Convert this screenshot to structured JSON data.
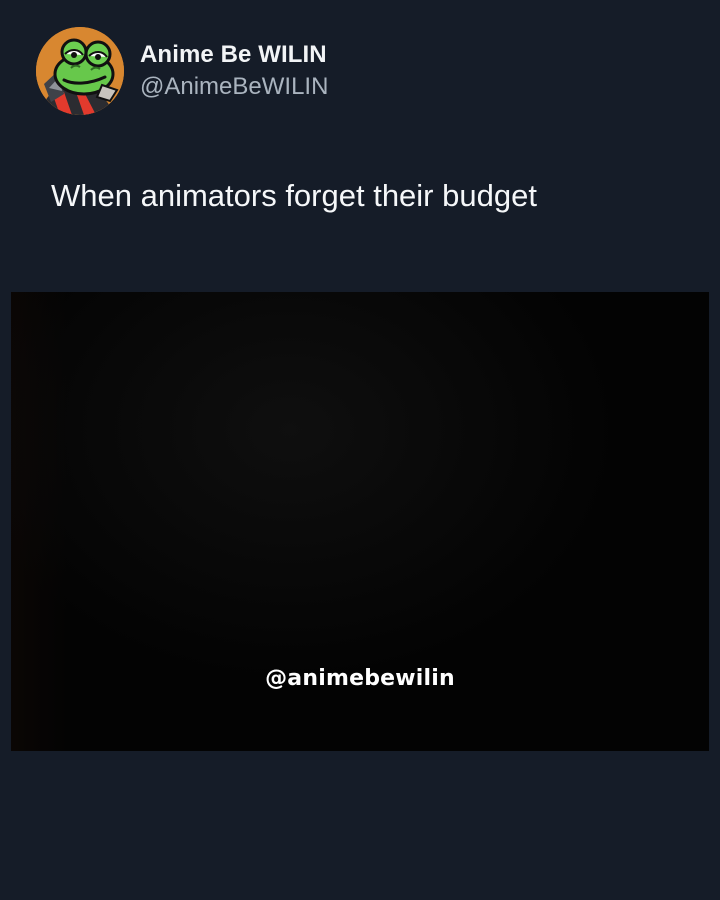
{
  "post": {
    "author": {
      "display_name": "Anime Be WILIN",
      "handle": "@AnimeBeWILIN",
      "avatar_icon": "frog-character-avatar"
    },
    "text": "When animators forget their budget"
  },
  "media": {
    "type": "video-still",
    "watermark": "@animebewilin"
  },
  "colors": {
    "background": "#151c28",
    "media_background": "#030303",
    "primary_text": "#f5f7f9",
    "secondary_text": "#aab4bf",
    "avatar_orange": "#d88730",
    "avatar_green": "#67c84b"
  }
}
